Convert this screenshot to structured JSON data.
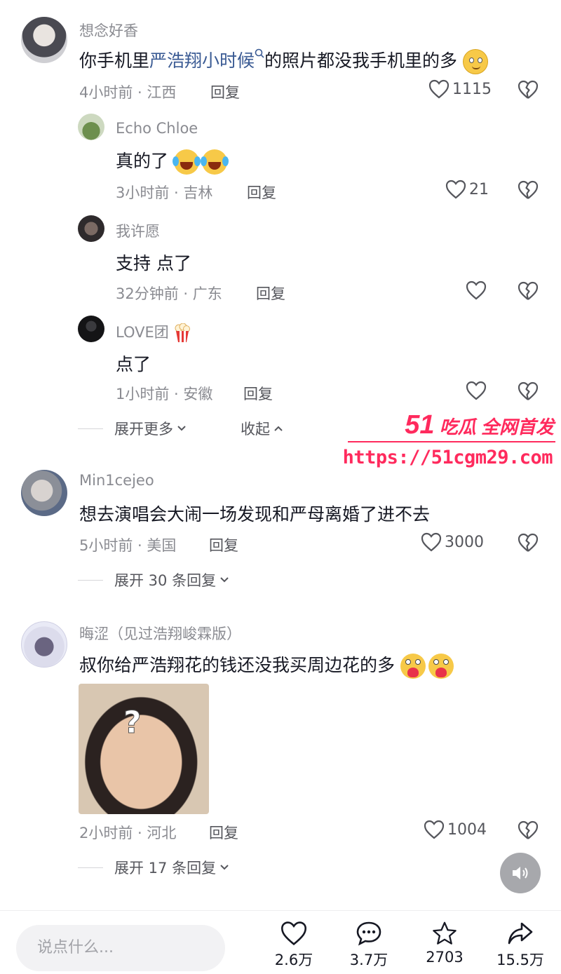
{
  "comments": [
    {
      "username": "想念好香",
      "text_before": "你手机里",
      "text_link": "严浩翔小时候",
      "text_after": "的照片都没我手机里的多",
      "time_location": "4小时前 · 江西",
      "reply_label": "回复",
      "likes": "1115"
    },
    {
      "username": "Min1cejeo",
      "text": "想去演唱会大闹一场发现和严母离婚了进不去",
      "time_location": "5小时前 · 美国",
      "reply_label": "回复",
      "likes": "3000",
      "expand_label": "展开 30 条回复"
    },
    {
      "username": "晦涩（见过浩翔峻霖版）",
      "text": "叔你给严浩翔花的钱还没我买周边花的多",
      "time_location": "2小时前 · 河北",
      "reply_label": "回复",
      "likes": "1004",
      "expand_label": "展开 17 条回复"
    }
  ],
  "replies": [
    {
      "username": "Echo Chloe",
      "text": "真的了",
      "time_location": "3小时前 · 吉林",
      "reply_label": "回复",
      "likes": "21"
    },
    {
      "username": "我许愿",
      "text": "支持 点了",
      "time_location": "32分钟前 · 广东",
      "reply_label": "回复",
      "likes": ""
    },
    {
      "username": "LOVE团",
      "text": "点了",
      "time_location": "1小时前 · 安徽",
      "reply_label": "回复",
      "likes": ""
    }
  ],
  "thread_controls": {
    "expand_more": "展开更多",
    "collapse": "收起"
  },
  "watermark": {
    "line1_num": "51",
    "line1_text": "吃瓜 全网首发",
    "line2": "https://51cgm29.com"
  },
  "input": {
    "placeholder": "说点什么..."
  },
  "actions": [
    {
      "icon": "heart-icon",
      "count": "2.6万"
    },
    {
      "icon": "comment-icon",
      "count": "3.7万"
    },
    {
      "icon": "star-icon",
      "count": "2703"
    },
    {
      "icon": "share-icon",
      "count": "15.5万"
    }
  ],
  "colors": {
    "accent_link": "#3b5b94",
    "watermark": "#ff2a5d",
    "meta_gray": "#8a8b91"
  }
}
